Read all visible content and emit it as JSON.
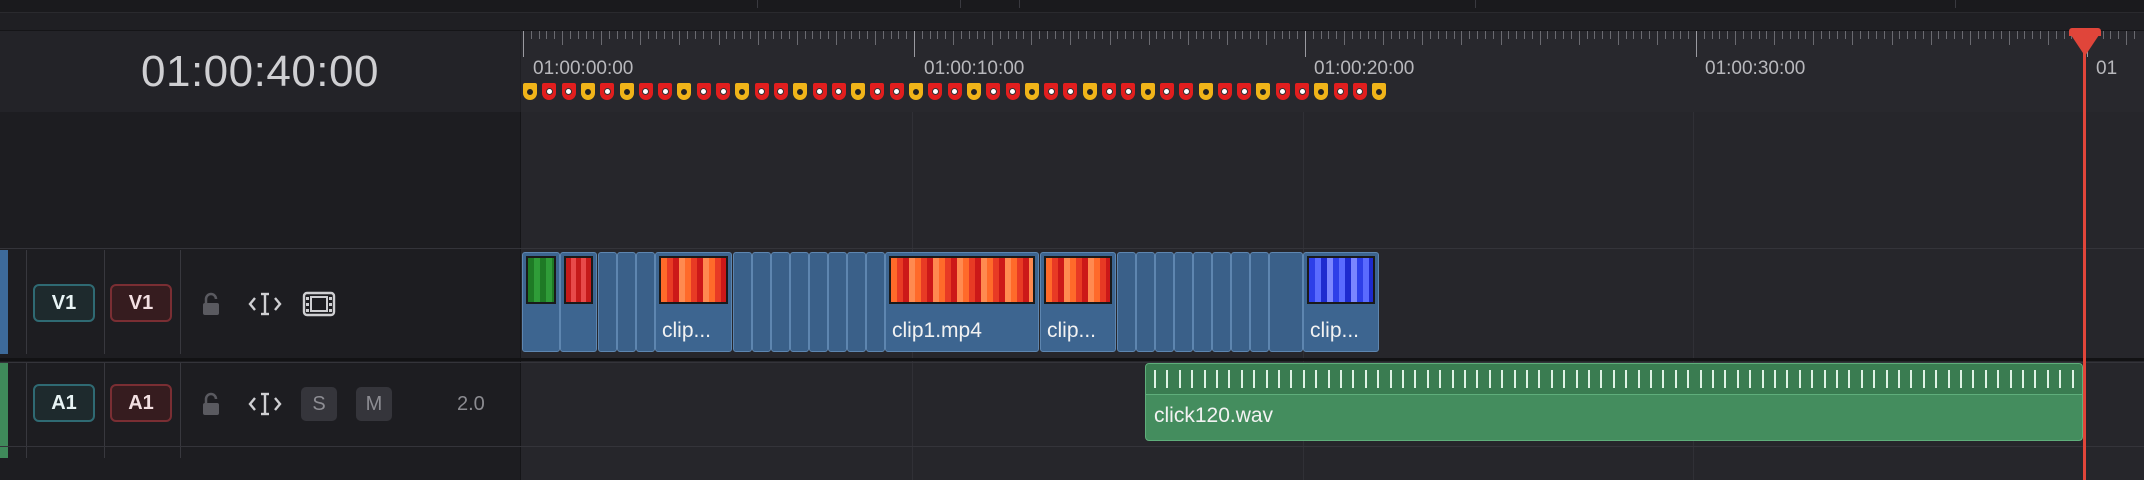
{
  "timecode": "01:00:40:00",
  "ruler": {
    "labels": [
      "01:00:00:00",
      "01:00:10:00",
      "01:00:20:00",
      "01:00:30:00",
      "01"
    ]
  },
  "markers": [
    "yellow",
    "red",
    "red",
    "yellow",
    "red",
    "yellow",
    "red",
    "red",
    "yellow",
    "red",
    "red",
    "yellow",
    "red",
    "red",
    "yellow",
    "red",
    "red",
    "yellow",
    "red",
    "red",
    "yellow",
    "red",
    "red",
    "yellow",
    "red",
    "red",
    "yellow",
    "red",
    "red",
    "yellow",
    "red",
    "red",
    "yellow",
    "red",
    "red",
    "yellow",
    "red",
    "red",
    "yellow",
    "red",
    "red",
    "yellow",
    "red",
    "red",
    "yellow"
  ],
  "tracks": {
    "video": {
      "source_patch": "V1",
      "dest": "V1",
      "lock_icon": "lock-icon",
      "auto_select_icon": "auto-select-icon",
      "toggle_icon": "film-strip-icon",
      "accent_color": "#3d6a9a"
    },
    "audio": {
      "source_patch": "A1",
      "dest": "A1",
      "lock_icon": "lock-icon",
      "auto_select_icon": "auto-select-icon",
      "solo": "S",
      "mute": "M",
      "channels": "2.0",
      "accent_color": "#3f8a5a"
    }
  },
  "video_clips": [
    {
      "name": "",
      "kind": "thumb",
      "thumb": "green"
    },
    {
      "name": "",
      "kind": "thumb",
      "thumb": "red"
    },
    {
      "name": "",
      "kind": "thin"
    },
    {
      "name": "",
      "kind": "thin"
    },
    {
      "name": "",
      "kind": "thin"
    },
    {
      "name": "clip...",
      "kind": "thumb",
      "thumb": "redorange"
    },
    {
      "name": "",
      "kind": "thin"
    },
    {
      "name": "",
      "kind": "thin"
    },
    {
      "name": "",
      "kind": "thin"
    },
    {
      "name": "",
      "kind": "thin"
    },
    {
      "name": "",
      "kind": "thin"
    },
    {
      "name": "",
      "kind": "thin"
    },
    {
      "name": "",
      "kind": "thin"
    },
    {
      "name": "",
      "kind": "thin"
    },
    {
      "name": "clip1.mp4",
      "kind": "thumb",
      "thumb": "redorange"
    },
    {
      "name": "clip...",
      "kind": "thumb",
      "thumb": "redorange"
    },
    {
      "name": "",
      "kind": "thin"
    },
    {
      "name": "",
      "kind": "thin"
    },
    {
      "name": "",
      "kind": "thin"
    },
    {
      "name": "",
      "kind": "thin"
    },
    {
      "name": "",
      "kind": "thin"
    },
    {
      "name": "",
      "kind": "thin"
    },
    {
      "name": "",
      "kind": "thin"
    },
    {
      "name": "",
      "kind": "thin"
    },
    {
      "name": "clip...",
      "kind": "thumb",
      "thumb": "blue"
    }
  ],
  "audio_clip": {
    "name": "click120.wav"
  }
}
